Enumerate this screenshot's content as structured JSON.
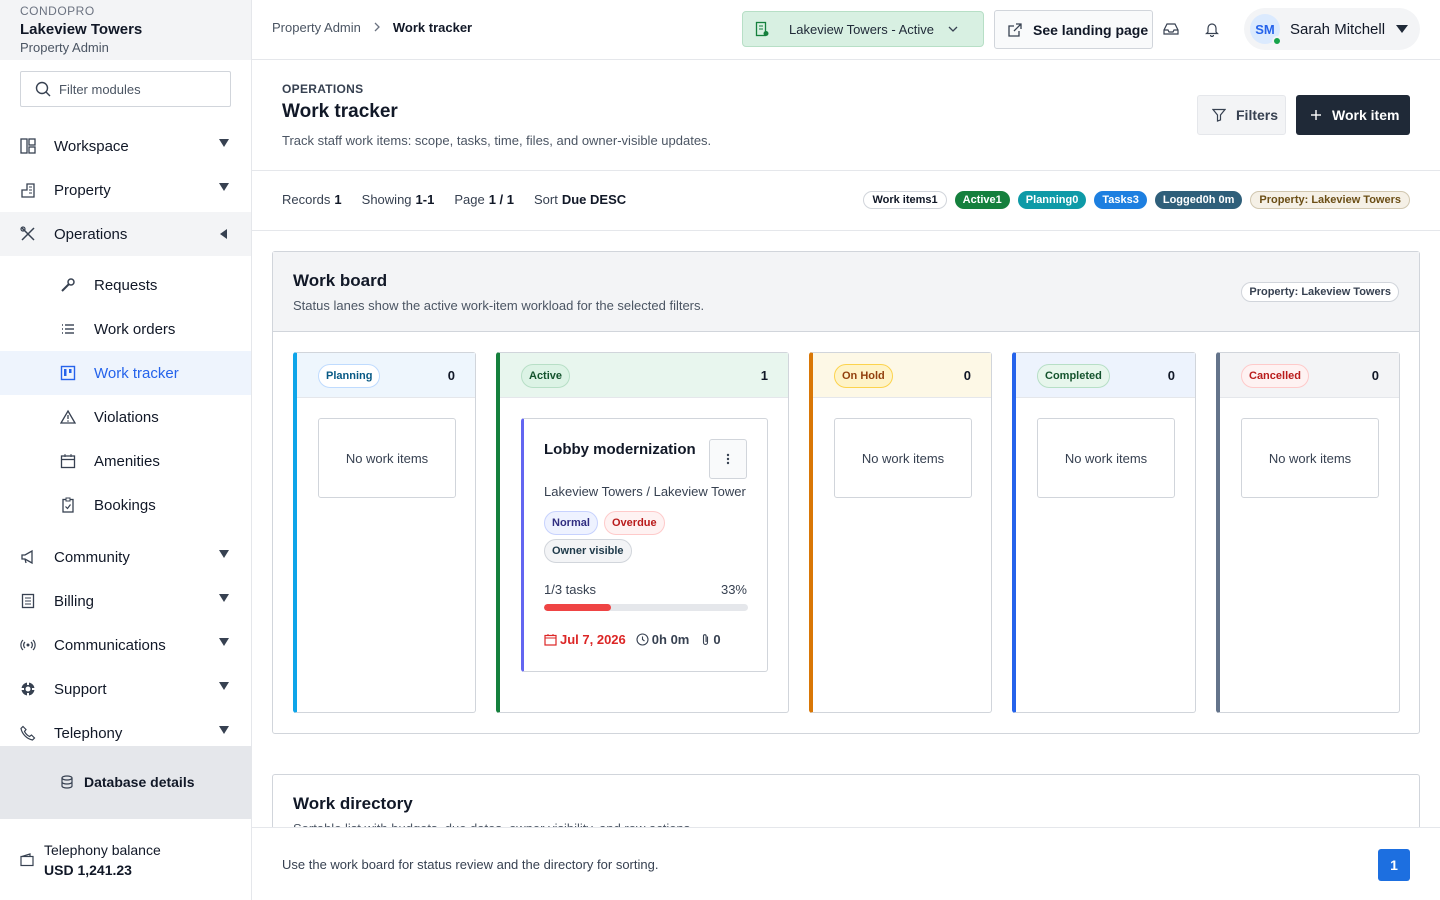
{
  "sidebar": {
    "kicker": "CONDOPRO",
    "property_name": "Lakeview Towers",
    "role": "Property Admin",
    "filter_placeholder": "Filter modules",
    "items": [
      {
        "label": "Workspace",
        "icon": "layout-icon"
      },
      {
        "label": "Property",
        "icon": "building-icon"
      },
      {
        "label": "Operations",
        "icon": "tools-icon"
      },
      {
        "label": "Community",
        "icon": "megaphone-icon"
      },
      {
        "label": "Billing",
        "icon": "receipt-icon"
      },
      {
        "label": "Communications",
        "icon": "broadcast-icon"
      },
      {
        "label": "Support",
        "icon": "lifebuoy-icon"
      },
      {
        "label": "Telephony",
        "icon": "phone-icon"
      }
    ],
    "sub_items": [
      {
        "label": "Requests",
        "icon": "wrench-icon"
      },
      {
        "label": "Work orders",
        "icon": "list-icon"
      },
      {
        "label": "Work tracker",
        "icon": "kanban-icon"
      },
      {
        "label": "Violations",
        "icon": "warning-icon"
      },
      {
        "label": "Amenities",
        "icon": "calendar-icon"
      },
      {
        "label": "Bookings",
        "icon": "clipboard-icon"
      }
    ],
    "database_label": "Database details",
    "balance_label": "Telephony balance",
    "balance_value": "USD 1,241.23"
  },
  "header": {
    "breadcrumb_root": "Property Admin",
    "breadcrumb_current": "Work tracker",
    "property_select": "Lakeview Towers - Active",
    "landing_button": "See landing page",
    "user_initials": "SM",
    "user_name": "Sarah Mitchell"
  },
  "page": {
    "kicker": "OPERATIONS",
    "title": "Work tracker",
    "description": "Track staff work items: scope, tasks, time, files, and owner-visible updates.",
    "filters_button": "Filters",
    "new_button": "Work item"
  },
  "stats": {
    "records_label": "Records",
    "records_value": "1",
    "showing_label": "Showing",
    "showing_value": "1-1",
    "page_label": "Page",
    "page_value": "1 / 1",
    "sort_label": "Sort",
    "sort_value": "Due DESC",
    "pills": {
      "work_items": "Work items1",
      "active": "Active1",
      "planning": "Planning0",
      "tasks": "Tasks3",
      "logged": "Logged0h 0m",
      "property": "Property: Lakeview Towers"
    }
  },
  "board": {
    "title": "Work board",
    "description": "Status lanes show the active work-item workload for the selected filters.",
    "property_tag": "Property: Lakeview Towers",
    "empty_text": "No work items",
    "lanes": [
      {
        "label": "Planning",
        "count": "0",
        "color": "#0ea5e9"
      },
      {
        "label": "Active",
        "count": "1",
        "color": "#15803d"
      },
      {
        "label": "On Hold",
        "count": "0",
        "color": "#d97706"
      },
      {
        "label": "Completed",
        "count": "0",
        "color": "#2563eb"
      },
      {
        "label": "Cancelled",
        "count": "0",
        "color": "#64748b"
      }
    ],
    "card": {
      "title": "Lobby modernization",
      "location": "Lakeview Towers / Lakeview Tower",
      "priority": "Normal",
      "status": "Overdue",
      "visibility": "Owner visible",
      "tasks": "1/3 tasks",
      "percent": "33%",
      "progress": 0.33,
      "due": "Jul 7, 2026",
      "time": "0h 0m",
      "attachments": "0"
    }
  },
  "directory": {
    "title": "Work directory",
    "description": "Sortable list with budgets, due dates, owner visibility, and row actions."
  },
  "footer": {
    "text": "Use the work board for status review and the directory for sorting.",
    "page": "1"
  },
  "colors": {
    "accent": "#2563eb",
    "primary_dark": "#1f2937",
    "danger": "#dc2626",
    "success": "#15803d"
  }
}
